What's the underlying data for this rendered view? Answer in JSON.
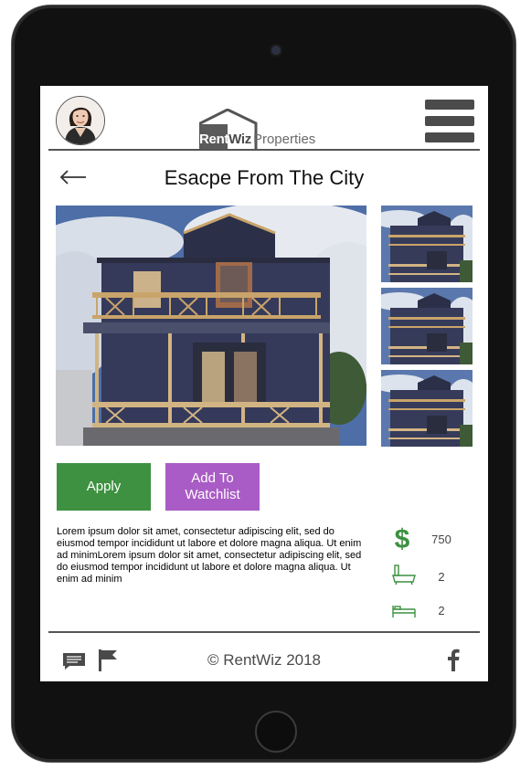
{
  "header": {
    "logo_rent": "Rent",
    "logo_wiz": "Wiz",
    "logo_properties": "Properties"
  },
  "listing": {
    "title": "Esacpe From The City",
    "apply_label": "Apply",
    "watchlist_label": "Add To Watchlist",
    "description": "Lorem ipsum dolor sit amet, consectetur adipiscing elit, sed do eiusmod tempor incididunt ut labore et dolore magna aliqua. Ut enim ad minimLorem ipsum dolor sit amet, consectetur adipiscing elit, sed do eiusmod tempor incididunt ut labore et dolore magna aliqua. Ut enim ad minim"
  },
  "stats": {
    "price": "750",
    "bathrooms": "2",
    "bedrooms": "2"
  },
  "footer": {
    "copyright": "© RentWiz 2018"
  },
  "icons": [
    "avatar",
    "menu-icon",
    "back-arrow-icon",
    "dollar-icon",
    "bathtub-icon",
    "bed-icon",
    "chat-icon",
    "flag-icon",
    "facebook-icon"
  ],
  "colors": {
    "apply": "#3d9140",
    "watchlist": "#a95cc5",
    "stat_icon": "#3d9140",
    "divider": "#555555"
  }
}
